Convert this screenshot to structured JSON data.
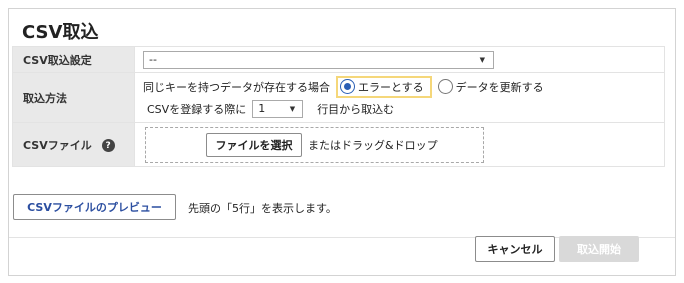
{
  "page": {
    "title": "CSV取込"
  },
  "form": {
    "settings": {
      "label": "CSV取込設定",
      "value": "--"
    },
    "method": {
      "label": "取込方法",
      "prefix": "同じキーを持つデータが存在する場合",
      "option_error": "エラーとする",
      "option_update": "データを更新する",
      "row_prefix": "CSVを登録する際に",
      "row_value": "1",
      "row_suffix": "行目から取込む"
    },
    "file": {
      "label": "CSVファイル",
      "help_glyph": "?",
      "choose_button": "ファイルを選択",
      "drop_text": "またはドラッグ&ドロップ"
    }
  },
  "preview": {
    "button": "CSVファイルのプレビュー",
    "note": "先頭の「5行」を表示します。"
  },
  "footer": {
    "cancel": "キャンセル",
    "start": "取込開始"
  },
  "icons": {
    "caret": "▼",
    "help": "question-circle-icon"
  },
  "colors": {
    "accent": "#2a5fb5",
    "highlight": "#f5d77a",
    "label_bg": "#e9e9e9",
    "disabled_btn": "#d9d9d9",
    "link": "#2b4ea0"
  }
}
